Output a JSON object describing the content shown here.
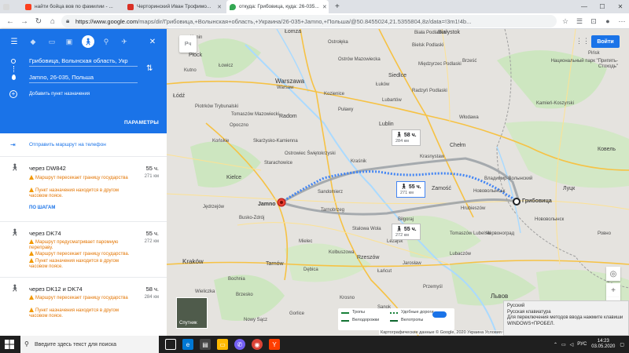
{
  "browser": {
    "tabs": [
      {
        "title": "найти бойца вов по фамилии - ..."
      },
      {
        "title": "Черторинский Иван Трофимо..."
      },
      {
        "title": "откуда: Грибовица, куда: 26-035..."
      }
    ],
    "new_tab": "+",
    "window_controls": {
      "minimize": "—",
      "maximize": "☐",
      "close": "✕"
    },
    "url_host": "https://www.google.com",
    "url_path": "/maps/dir/Грибовица,+Волынская+область,+Украина/26-035+Jamno,+Польша/@50.8455024,21.5355804,8z/data=!3m1!4b..."
  },
  "panel": {
    "origin": "Грибовица, Волынская область, Укр",
    "destination": "Jamno, 26-035, Польша",
    "add_destination": "Добавить пункт назначения",
    "params": "ПАРАМЕТРЫ",
    "send_to_phone": "Отправить маршрут на телефон",
    "routes": [
      {
        "via": "через DW842",
        "duration": "55 ч.",
        "distance": "271 км",
        "warnings": [
          "Маршрут пересекает границу государства",
          "Пункт назначения находится в другом часовом поясе."
        ],
        "steps": "ПО ШАГАМ"
      },
      {
        "via": "через DK74",
        "duration": "55 ч.",
        "distance": "272 км",
        "warnings": [
          "Маршрут предусматривает паромную переправу.",
          "Маршрут пересекает границу государства.",
          "Пункт назначения находится в другом часовом поясе."
        ]
      },
      {
        "via": "через DK12 и DK74",
        "duration": "58 ч.",
        "distance": "284 км",
        "warnings": [
          "Маршрут пересекает границу государства",
          "Пункт назначения находится в другом часовом поясе."
        ]
      }
    ]
  },
  "map": {
    "search_placeholder": "Рч",
    "login": "Войти",
    "labels": [
      {
        "text": "Łomża",
        "cls": "city"
      },
      {
        "text": "Białystok",
        "cls": "city"
      },
      {
        "text": "Ostrołęka",
        "cls": ""
      },
      {
        "text": "Ostrów Mazowiecka",
        "cls": ""
      },
      {
        "text": "Bielsk Podlaski",
        "cls": ""
      },
      {
        "text": "Biała Podlaska",
        "cls": ""
      },
      {
        "text": "Płock",
        "cls": "city"
      },
      {
        "text": "Warszawa",
        "cls": "big"
      },
      {
        "text": "Warsaw",
        "cls": ""
      },
      {
        "text": "Siedlce",
        "cls": "city"
      },
      {
        "text": "Kutno",
        "cls": ""
      },
      {
        "text": "Łowicz",
        "cls": ""
      },
      {
        "text": "Łódź",
        "cls": "city"
      },
      {
        "text": "Radom",
        "cls": "city"
      },
      {
        "text": "Puławy",
        "cls": ""
      },
      {
        "text": "Lublin",
        "cls": "city"
      },
      {
        "text": "Lubartów",
        "cls": ""
      },
      {
        "text": "Chełm",
        "cls": "city"
      },
      {
        "text": "Kielce",
        "cls": "city"
      },
      {
        "text": "Starachowice",
        "cls": ""
      },
      {
        "text": "Skarżysko-Kamienna",
        "cls": ""
      },
      {
        "text": "Kraśnik",
        "cls": ""
      },
      {
        "text": "Krasnystaw",
        "cls": ""
      },
      {
        "text": "Zamość",
        "cls": "city"
      },
      {
        "text": "Sandomierz",
        "cls": ""
      },
      {
        "text": "Ковель",
        "cls": "city"
      },
      {
        "text": "Владимир-Волынский",
        "cls": ""
      },
      {
        "text": "Нововолынськ",
        "cls": ""
      },
      {
        "text": "Червоноград",
        "cls": ""
      },
      {
        "text": "Jędrzejów",
        "cls": ""
      },
      {
        "text": "Busko-Zdrój",
        "cls": ""
      },
      {
        "text": "Tarnobrzeg",
        "cls": ""
      },
      {
        "text": "Stalowa Wola",
        "cls": ""
      },
      {
        "text": "Biłgoraj",
        "cls": ""
      },
      {
        "text": "Tomaszów Lubelski",
        "cls": ""
      },
      {
        "text": "Kraków",
        "cls": "big"
      },
      {
        "text": "Tarnów",
        "cls": "city"
      },
      {
        "text": "Rzeszów",
        "cls": "city"
      },
      {
        "text": "Mielec",
        "cls": ""
      },
      {
        "text": "Dębica",
        "cls": ""
      },
      {
        "text": "Jarosław",
        "cls": ""
      },
      {
        "text": "Przemyśl",
        "cls": ""
      },
      {
        "text": "Львов",
        "cls": "big"
      },
      {
        "text": "Bochnia",
        "cls": ""
      },
      {
        "text": "Nowy Sącz",
        "cls": ""
      },
      {
        "text": "Gorlice",
        "cls": ""
      },
      {
        "text": "Krosno",
        "cls": ""
      },
      {
        "text": "Sanok",
        "cls": ""
      },
      {
        "text": "Wieliczka",
        "cls": ""
      },
      {
        "text": "Brzesko",
        "cls": ""
      },
      {
        "text": "Kolbuszowa",
        "cls": ""
      },
      {
        "text": "Łańcut",
        "cls": ""
      },
      {
        "text": "Leżajsk",
        "cls": ""
      },
      {
        "text": "Lubaczów",
        "cls": ""
      },
      {
        "text": "Konin",
        "cls": ""
      },
      {
        "text": "Końskie",
        "cls": ""
      },
      {
        "text": "Opoczno",
        "cls": ""
      },
      {
        "text": "Piotrków Trybunalski",
        "cls": ""
      },
      {
        "text": "Tomaszów Mazowiecki",
        "cls": ""
      },
      {
        "text": "Ostrowiec Świętokrzyski",
        "cls": ""
      },
      {
        "text": "Kozienice",
        "cls": ""
      },
      {
        "text": "Łuków",
        "cls": ""
      },
      {
        "text": "Radzyń Podlaski",
        "cls": ""
      },
      {
        "text": "Międzyrzec Podlaski",
        "cls": ""
      },
      {
        "text": "Włodawa",
        "cls": ""
      },
      {
        "text": "Hrubieszów",
        "cls": ""
      },
      {
        "text": "Brześć",
        "cls": ""
      },
      {
        "text": "Kamień-Koszyrski",
        "cls": ""
      },
      {
        "text": "Луцк",
        "cls": "city"
      },
      {
        "text": "Ровно",
        "cls": ""
      },
      {
        "text": "Нововолынск",
        "cls": ""
      },
      {
        "text": "Pińsk",
        "cls": ""
      },
      {
        "text": "Национальный парк \"Припять-Стоходь\"",
        "cls": ""
      },
      {
        "text": "Jamno",
        "cls": "city"
      },
      {
        "text": "Грибовица",
        "cls": "city"
      }
    ],
    "callouts": [
      {
        "time": "58 ч.",
        "dist": "284 км"
      },
      {
        "time": "55 ч.",
        "dist": "271 км"
      },
      {
        "time": "55 ч.",
        "dist": "272 км"
      }
    ],
    "satellite": "Спутник",
    "legend": {
      "a": "Тропы",
      "b": "Удобные дороги",
      "c": "Велодорожки",
      "d": "Велотропы"
    },
    "attribution": "Картографические данные © Google, 2020  Украина  Условия  Оставить отзыв  50 km",
    "ime": {
      "l1": "Русский",
      "l2": "Русская клавиатура",
      "l3": "Для переключения методов ввода нажмите клавиши WINDOWS+ПРОБЕЛ."
    }
  },
  "taskbar": {
    "search_placeholder": "Введите здесь текст для поиска",
    "lang": "РУС",
    "time": "14:23",
    "date": "03.05.2020"
  },
  "colors": {
    "accent": "#1a73e8",
    "route_primary": "#4285f4",
    "route_alt": "#9aa0a6",
    "warning": "#e37400"
  }
}
